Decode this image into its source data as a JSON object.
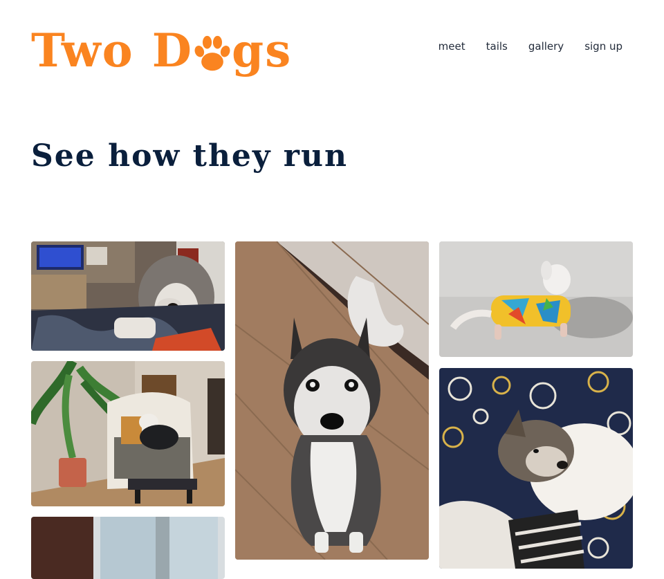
{
  "brand": {
    "name_part1": "Two",
    "name_part2": "D",
    "name_part3": "gs",
    "accent": "#fa8420"
  },
  "nav": {
    "items": [
      {
        "label": "meet"
      },
      {
        "label": "tails"
      },
      {
        "label": "gallery"
      },
      {
        "label": "sign up"
      }
    ]
  },
  "heading": "See how they run",
  "gallery": {
    "photos": [
      {
        "id": "husky-bed",
        "icon": "photo"
      },
      {
        "id": "small-dog-armchair",
        "icon": "photo"
      },
      {
        "id": "window-room",
        "icon": "photo"
      },
      {
        "id": "husky-wood-floor",
        "icon": "photo"
      },
      {
        "id": "small-dog-shirt",
        "icon": "photo"
      },
      {
        "id": "puppy-paisley",
        "icon": "photo"
      }
    ]
  },
  "colors": {
    "heading": "#0a1f3c",
    "nav": "#222b3a"
  }
}
